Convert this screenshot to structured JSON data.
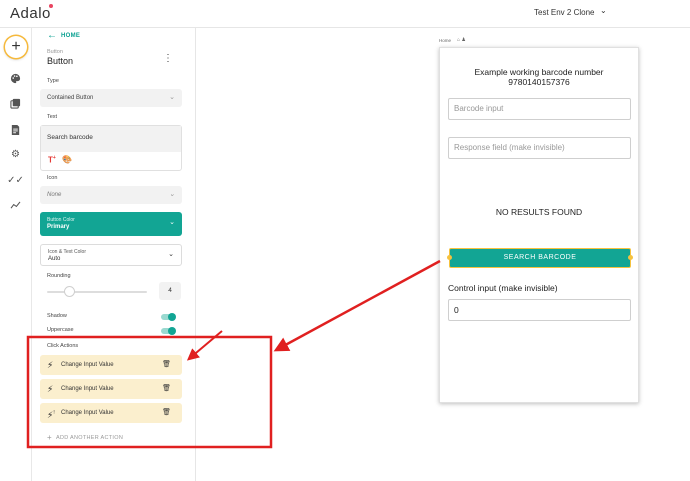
{
  "topbar": {
    "logo": "Adalo",
    "app_name": "Test Env 2 Clone"
  },
  "rail": {
    "add_symbol": "+",
    "icons": [
      "add-icon",
      "palette-icon",
      "screens-icon",
      "component-icon",
      "settings-icon",
      "publish-icon",
      "analytics-icon"
    ]
  },
  "panel": {
    "home_link": "HOME",
    "component_subtitle": "Button",
    "component_title": "Button",
    "type_label": "Type",
    "type_value": "Contained Button",
    "text_label": "Text",
    "text_value": "Search barcode",
    "icon_label": "Icon",
    "icon_value": "None",
    "button_color_label": "Button Color",
    "button_color_value": "Primary",
    "icon_text_color_label": "Icon & Text Color",
    "icon_text_color_value": "Auto",
    "rounding_label": "Rounding",
    "rounding_value": "4",
    "rounding_fraction": 0.17,
    "shadow_label": "Shadow",
    "shadow_on": true,
    "uppercase_label": "Uppercase",
    "uppercase_on": true,
    "click_actions_label": "Click Actions",
    "actions": [
      {
        "label": "Change Input Value",
        "icon": "bolt-icon"
      },
      {
        "label": "Change Input Value",
        "icon": "bolt-icon"
      },
      {
        "label": "Change Input Value",
        "icon": "bolt-warning-icon"
      }
    ],
    "add_action": "ADD ANOTHER ACTION"
  },
  "canvas": {
    "screen_label": "Home",
    "screen_title_line1": "Example working barcode number",
    "screen_title_line2": "9780140157376",
    "barcode_placeholder": "Barcode input",
    "response_placeholder": "Response field (make invisible)",
    "no_results": "NO RESULTS FOUND",
    "search_button": "SEARCH BARCODE",
    "control_label": "Control input (make invisible)",
    "control_value": "0"
  },
  "colors": {
    "accent": "#12a594",
    "highlight": "#e02020",
    "action_bg": "#fbefce",
    "selection": "#f6c23e"
  }
}
